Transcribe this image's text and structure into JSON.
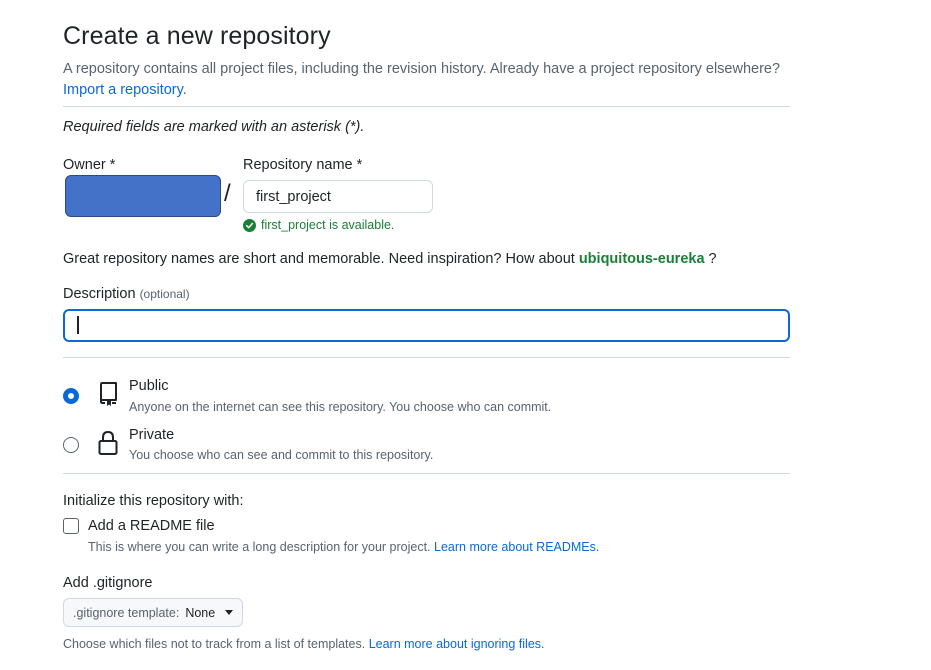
{
  "header": {
    "title": "Create a new repository",
    "intro_text": "A repository contains all project files, including the revision history. Already have a project repository elsewhere?",
    "import_link": "Import a repository."
  },
  "required_note": "Required fields are marked with an asterisk (*).",
  "owner": {
    "label": "Owner *",
    "color": "#4472c9"
  },
  "slash": "/",
  "repo_name": {
    "label": "Repository name *",
    "value": "first_project",
    "availability": "first_project is available.",
    "availability_icon": "check-circle-icon"
  },
  "inspiration": {
    "text": "Great repository names are short and memorable. Need inspiration? How about",
    "suggestion": "ubiquitous-eureka",
    "suffix": "?"
  },
  "description": {
    "label": "Description",
    "optional": "(optional)",
    "value": ""
  },
  "visibility": {
    "selected": "public",
    "options": [
      {
        "title": "Public",
        "desc": "Anyone on the internet can see this repository. You choose who can commit.",
        "icon": "repo-icon"
      },
      {
        "title": "Private",
        "desc": "You choose who can see and commit to this repository.",
        "icon": "lock-icon"
      }
    ]
  },
  "initialize": {
    "label": "Initialize this repository with:",
    "readme": {
      "label": "Add a README file",
      "checked": false,
      "desc": "This is where you can write a long description for your project.",
      "link": "Learn more about READMEs."
    }
  },
  "gitignore": {
    "label": "Add .gitignore",
    "prefix": ".gitignore template:",
    "value": "None",
    "help": "Choose which files not to track from a list of templates.",
    "link": "Learn more about ignoring files."
  },
  "colors": {
    "accent": "#0969da",
    "success": "#1a7f37"
  }
}
